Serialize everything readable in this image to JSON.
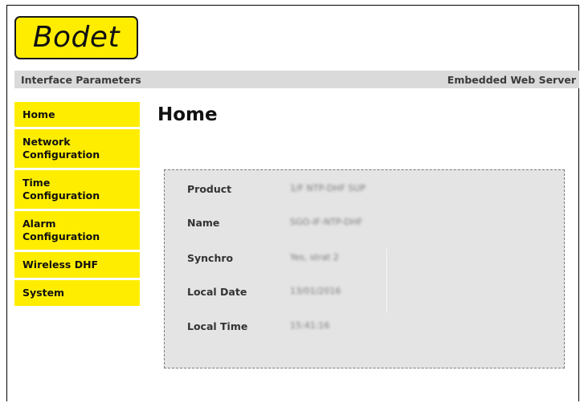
{
  "logo": {
    "text": "Bodet"
  },
  "header": {
    "left": "Interface Parameters",
    "right": "Embedded Web Server"
  },
  "nav": {
    "items": [
      {
        "label": "Home"
      },
      {
        "label": "Network\nConfiguration"
      },
      {
        "label": "Time\nConfiguration"
      },
      {
        "label": "Alarm\nConfiguration"
      },
      {
        "label": "Wireless DHF"
      },
      {
        "label": "System"
      }
    ]
  },
  "main": {
    "title": "Home",
    "fields": [
      {
        "label": "Product",
        "value": "1/F NTP-DHF SUP"
      },
      {
        "label": "Name",
        "value": "SGO-IF-NTP-DHF"
      },
      {
        "label": "Synchro",
        "value": "Yes, strat 2"
      },
      {
        "label": "Local Date",
        "value": "13/01/2016"
      },
      {
        "label": "Local Time",
        "value": "15:41:16"
      }
    ]
  },
  "colors": {
    "accent": "#ffed00",
    "bar": "#dadada",
    "panel": "#e4e4e4"
  }
}
